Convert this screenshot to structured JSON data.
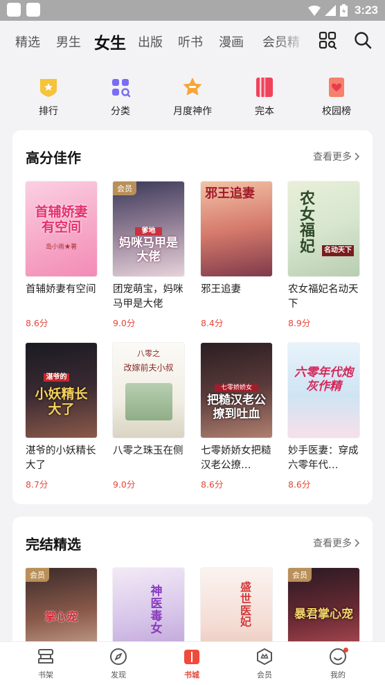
{
  "status_bar": {
    "time": "3:23"
  },
  "top_nav": {
    "tabs": [
      "精选",
      "男生",
      "女生",
      "出版",
      "听书",
      "漫画",
      "会员精"
    ],
    "active_index": 2
  },
  "quick_links": [
    {
      "label": "排行",
      "icon": "ranking-icon"
    },
    {
      "label": "分类",
      "icon": "category-icon"
    },
    {
      "label": "月度神作",
      "icon": "monthly-star-icon"
    },
    {
      "label": "完本",
      "icon": "completed-book-icon"
    },
    {
      "label": "校园榜",
      "icon": "campus-list-icon"
    }
  ],
  "high_score": {
    "title": "高分佳作",
    "more": "查看更多",
    "books": [
      {
        "title": "首辅娇妻有空间",
        "score": "8.6分",
        "badge": "",
        "cover_text": "首辅娇妻有空间",
        "cover_sub": "岛小雨★著"
      },
      {
        "title": "团宠萌宝，妈咪马甲是大佬",
        "score": "9.0分",
        "badge": "会员",
        "cover_text": "妈咪马甲是大佬",
        "cover_sub": "爹地"
      },
      {
        "title": "邪王追妻",
        "score": "8.4分",
        "badge": "",
        "cover_text": "邪王追妻",
        "cover_sub": ""
      },
      {
        "title": "农女福妃名动天下",
        "score": "8.9分",
        "badge": "",
        "cover_text": "农女福妃",
        "cover_sub": "名动天下"
      },
      {
        "title": "湛爷的小妖精长大了",
        "score": "8.7分",
        "badge": "",
        "cover_text": "小妖精长大了",
        "cover_sub": "湛爷的"
      },
      {
        "title": "八零之珠玉在侧",
        "score": "9.0分",
        "badge": "",
        "cover_text": "八零之",
        "cover_sub": "改嫁前夫小叔"
      },
      {
        "title": "七零娇娇女把糙汉老公撩…",
        "score": "8.6分",
        "badge": "",
        "cover_text": "把糙汉老公撩到吐血",
        "cover_sub": "七零娇娇女"
      },
      {
        "title": "妙手医妻：穿成六零年代…",
        "score": "8.6分",
        "badge": "",
        "cover_text": "六零年代炮灰作精",
        "cover_sub": ""
      }
    ]
  },
  "finished": {
    "title": "完结精选",
    "more": "查看更多",
    "books": [
      {
        "badge": "会员",
        "cover_text": "掌心宠"
      },
      {
        "badge": "",
        "cover_text": "神医毒女"
      },
      {
        "badge": "",
        "cover_text": "盛世医妃"
      },
      {
        "badge": "会员",
        "cover_text": "暴君掌心宠"
      }
    ]
  },
  "bottom_tabs": [
    {
      "label": "书架",
      "icon": "bookshelf-icon"
    },
    {
      "label": "发现",
      "icon": "compass-icon"
    },
    {
      "label": "书城",
      "icon": "bookstore-icon"
    },
    {
      "label": "会员",
      "icon": "membership-icon"
    },
    {
      "label": "我的",
      "icon": "profile-icon"
    }
  ],
  "bottom_active_index": 2,
  "colors": {
    "accent": "#e4473a",
    "vip_badge": "#b9905a",
    "score": "#e4473a"
  }
}
